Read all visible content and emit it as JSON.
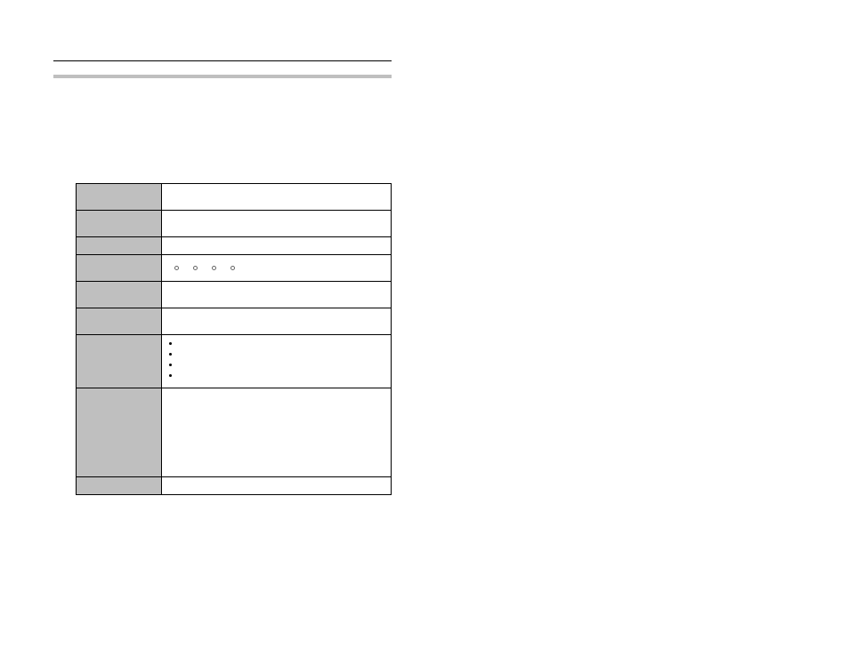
{
  "header": {
    "title": "",
    "subtitle": ""
  },
  "table": {
    "rows": [
      {
        "label": "",
        "value": ""
      },
      {
        "label": "",
        "value": ""
      },
      {
        "label": "",
        "value": ""
      },
      {
        "label": "",
        "value": "",
        "circles": 4
      },
      {
        "label": "",
        "value": ""
      },
      {
        "label": "",
        "value": ""
      },
      {
        "label": "",
        "bullets": [
          "",
          "",
          "",
          ""
        ]
      },
      {
        "label": "",
        "value": ""
      },
      {
        "label": "",
        "value": ""
      }
    ]
  }
}
